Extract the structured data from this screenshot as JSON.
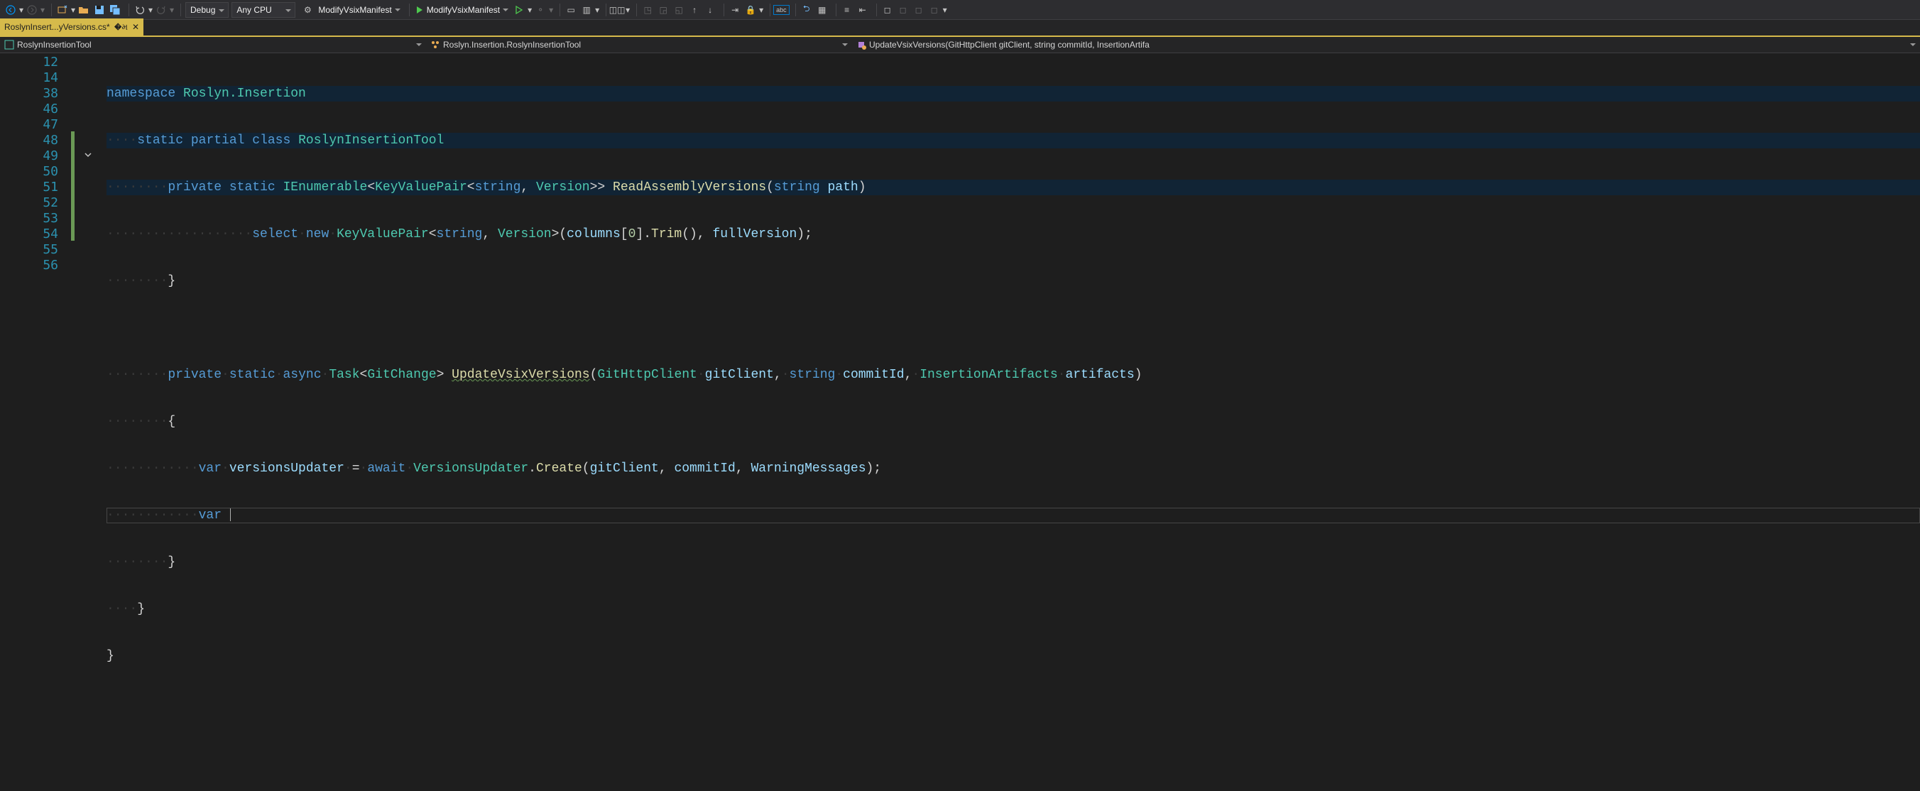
{
  "toolbar": {
    "config_dropdown": "Debug",
    "platform_dropdown": "Any CPU",
    "startup_project": "ModifyVsixManifest",
    "run_target": "ModifyVsixManifest",
    "abc_box": "abc"
  },
  "tab": {
    "title": "RoslynInsert...yVersions.cs*"
  },
  "navbar": {
    "project": "RoslynInsertionTool",
    "namespace": "Roslyn.Insertion.RoslynInsertionTool",
    "member": "UpdateVsixVersions(GitHttpClient gitClient, string commitId, InsertionArtifa"
  },
  "line_numbers": [
    "12",
    "14",
    "38",
    "46",
    "47",
    "48",
    "49",
    "50",
    "51",
    "52",
    "53",
    "54",
    "55",
    "56"
  ],
  "code": {
    "l12": {
      "kw1": "namespace",
      "ns": "Roslyn.Insertion"
    },
    "l14": {
      "kw1": "static",
      "kw2": "partial",
      "kw3": "class",
      "cls": "RoslynInsertionTool"
    },
    "l38": {
      "kw1": "private",
      "kw2": "static",
      "ret": "IEnumerable",
      "kvp": "KeyValuePair",
      "t1": "string",
      "t2": "Version",
      "method": "ReadAssemblyVersions",
      "p1t": "string",
      "p1n": "path"
    },
    "l46": {
      "kw": "select",
      "kw2": "new",
      "kvp": "KeyValuePair",
      "t1": "string",
      "t2": "Version",
      "arg1": "columns",
      "idx": "0",
      "m1": "Trim",
      "arg2": "fullVersion"
    },
    "l47": {
      "brace": "}"
    },
    "l49": {
      "kw1": "private",
      "kw2": "static",
      "kw3": "async",
      "task": "Task",
      "gc": "GitChange",
      "method": "UpdateVsixVersions",
      "p1t": "GitHttpClient",
      "p1n": "gitClient",
      "p2t": "string",
      "p2n": "commitId",
      "p3t": "InsertionArtifacts",
      "p3n": "artifacts"
    },
    "l50": {
      "brace": "{"
    },
    "l51": {
      "kw1": "var",
      "v": "versionsUpdater",
      "eq": "=",
      "kw2": "await",
      "cls": "VersionsUpdater",
      "m": "Create",
      "a1": "gitClient",
      "a2": "commitId",
      "a3": "WarningMessages"
    },
    "l52": {
      "kw1": "var"
    },
    "l53": {
      "brace": "}"
    },
    "l54": {
      "brace": "}"
    },
    "l55": {
      "brace": "}"
    }
  }
}
